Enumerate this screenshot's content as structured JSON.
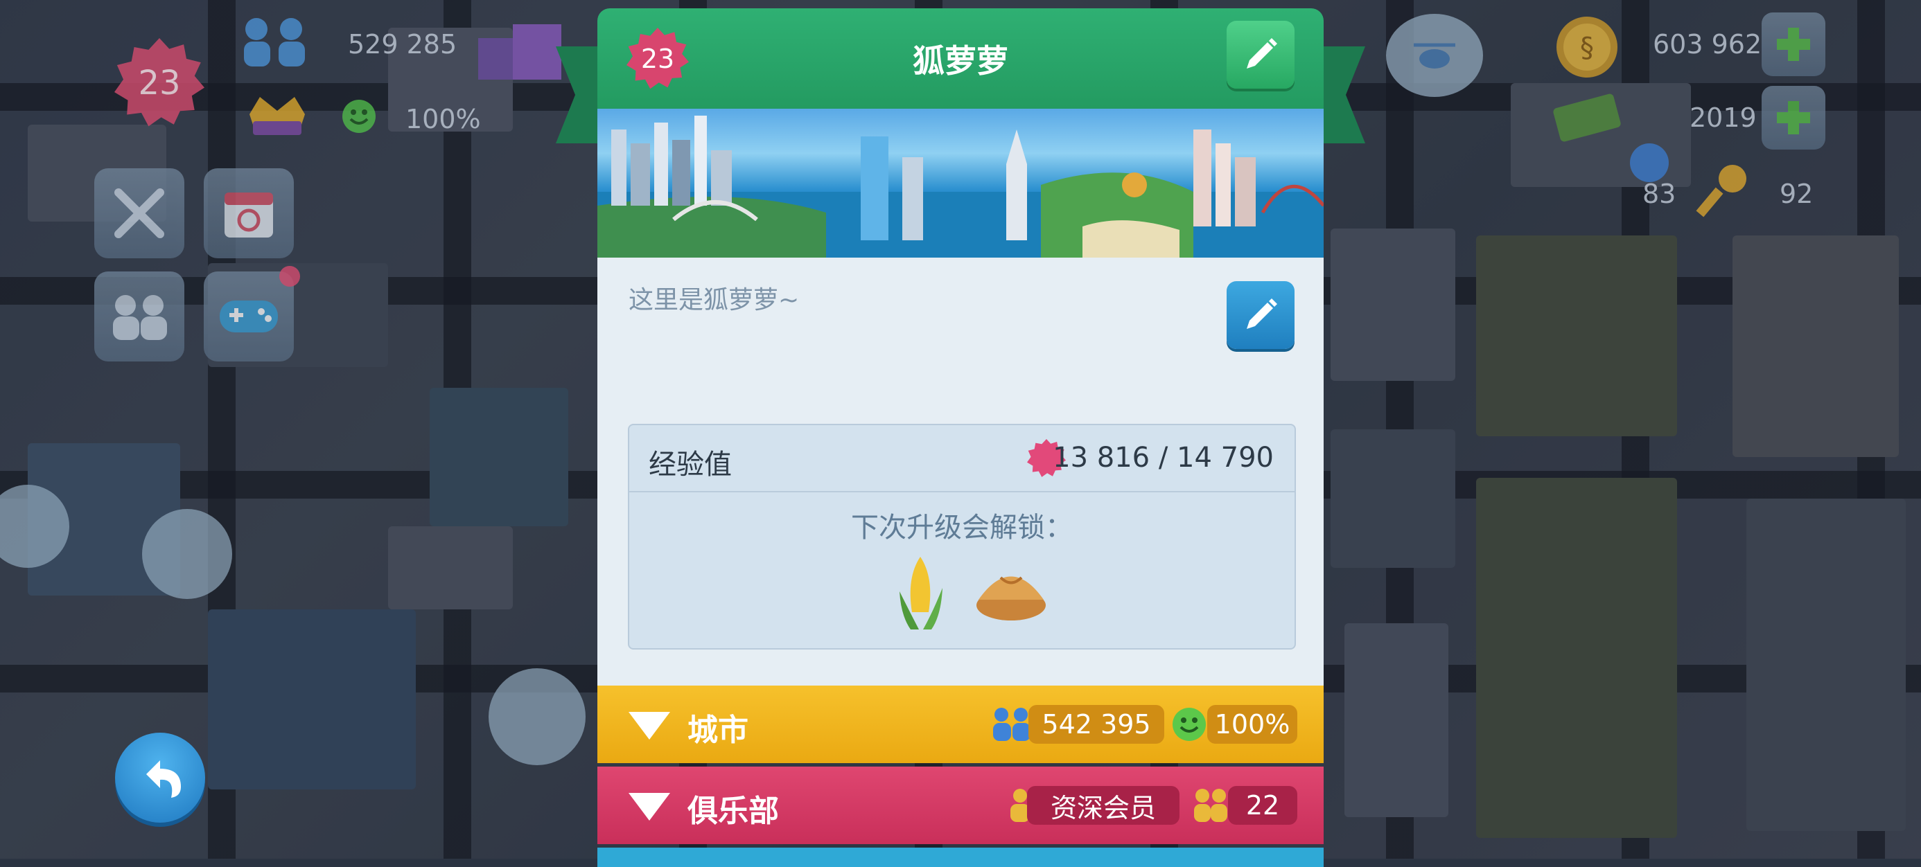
{
  "hud_left": {
    "level": "23",
    "population": "529 285",
    "happiness": "100%"
  },
  "hud_right": {
    "simoleons": "603 962",
    "simcash": "2019",
    "golden_keys_left": "83",
    "keys": "92"
  },
  "panel": {
    "level": "23",
    "player_name": "狐萝萝",
    "motto": "这里是狐萝萝~",
    "xp_label": "经验值",
    "xp_value": "13 816 / 14 790",
    "unlock_label": "下次升级会解锁："
  },
  "city_bar": {
    "label": "城市",
    "population": "542 395",
    "happiness": "100%",
    "color": "#f2b51d"
  },
  "club_bar": {
    "label": "俱乐部",
    "rank": "资深会员",
    "members": "22",
    "color": "#d83a64"
  },
  "icons": [
    "level-star-icon",
    "population-icon",
    "happiness-icon",
    "vip-icon",
    "tools-icon",
    "calendar-icon",
    "friends-icon",
    "gamepad-icon",
    "back-icon",
    "simoleon-icon",
    "simcash-icon",
    "plus-icon",
    "helicopter-icon",
    "edit-icon",
    "corn-icon",
    "bun-icon",
    "chevron-down-icon",
    "member-icon",
    "members-icon"
  ]
}
